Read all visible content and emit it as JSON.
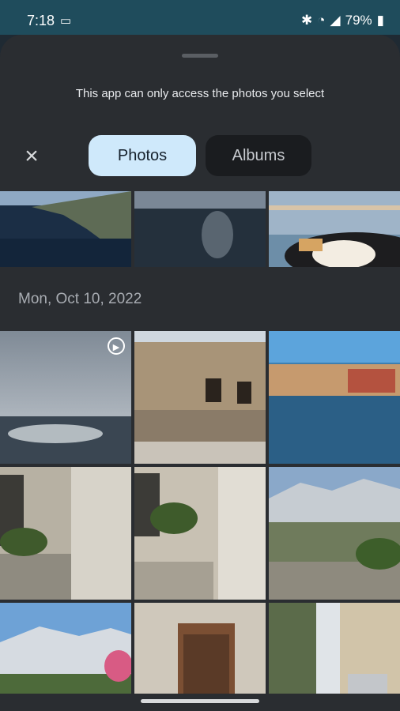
{
  "status_bar": {
    "time": "7:18",
    "battery": "79%"
  },
  "sheet": {
    "notice": "This app can only access the photos you select",
    "tabs": [
      {
        "label": "Photos",
        "selected": true
      },
      {
        "label": "Albums",
        "selected": false
      }
    ],
    "section_date": "Mon, Oct 10, 2022"
  },
  "colors": {
    "selected_tab": "#cfe9fb",
    "sheet_bg": "#2a2d31",
    "status_bg": "#1f4c5c"
  }
}
